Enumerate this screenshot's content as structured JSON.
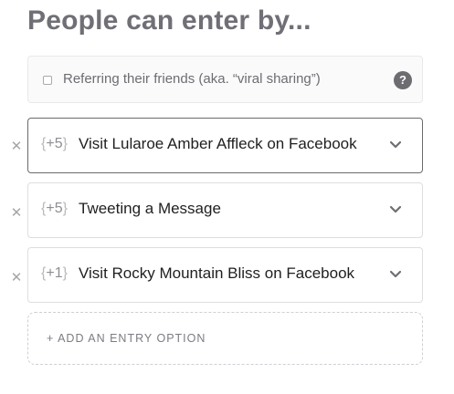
{
  "heading": "People can enter by...",
  "referral": {
    "label": "Referring their friends (aka. “viral sharing”)",
    "checked": false,
    "help_icon": "question-circle-icon",
    "help_glyph": "?"
  },
  "entries": [
    {
      "points_open": "{",
      "points": "+5",
      "points_close": "}",
      "title": "Visit Lularoe Amber Affleck on Facebook",
      "remove_glyph": "✕",
      "active": true
    },
    {
      "points_open": "{",
      "points": "+5",
      "points_close": "}",
      "title": "Tweeting a Message",
      "remove_glyph": "✕",
      "active": false
    },
    {
      "points_open": "{",
      "points": "+1",
      "points_close": "}",
      "title": "Visit Rocky Mountain Bliss on Facebook",
      "remove_glyph": "✕",
      "active": false
    }
  ],
  "add_entry": {
    "label": "+ ADD AN ENTRY OPTION"
  },
  "colors": {
    "heading": "#6f6f76",
    "active_border": "#6b6b6b",
    "border": "#dedee2",
    "help_icon_bg": "#6c6c71"
  }
}
